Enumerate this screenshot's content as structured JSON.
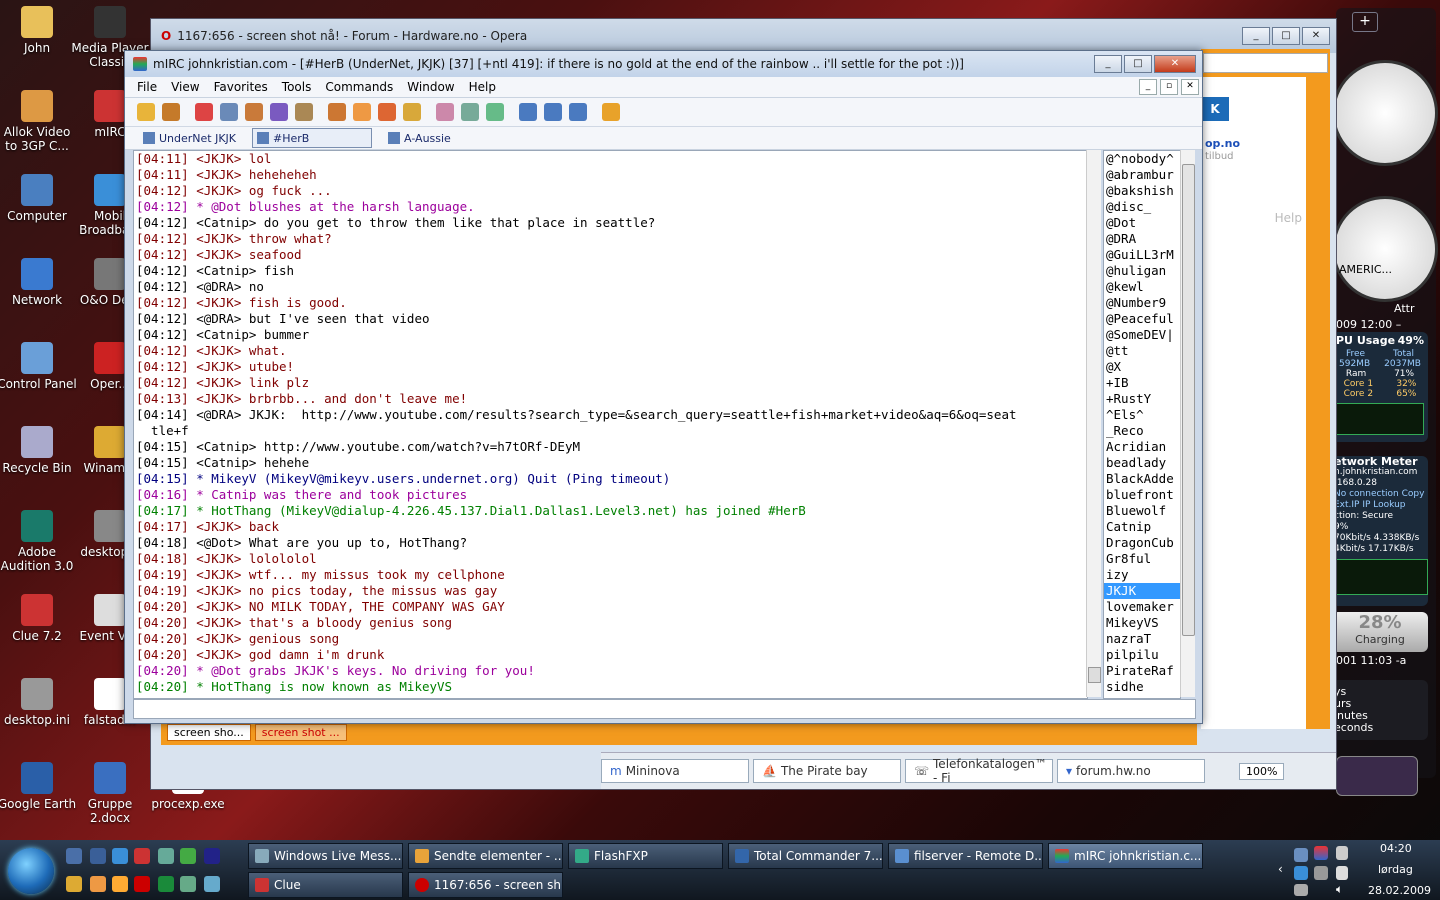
{
  "desktop": {
    "icons": [
      {
        "label": "John",
        "color": "#e8c05a"
      },
      {
        "label": "Media Player Classic",
        "color": "#333"
      },
      {
        "label": "Allok Video to 3GP C...",
        "color": "#d94"
      },
      {
        "label": "mIRC",
        "color": "#c33"
      },
      {
        "label": "Computer",
        "color": "#4a7fc0"
      },
      {
        "label": "Mobil Broadba...",
        "color": "#3a8fd8"
      },
      {
        "label": "Network",
        "color": "#3a7ad0"
      },
      {
        "label": "O&O De...",
        "color": "#777"
      },
      {
        "label": "Control Panel",
        "color": "#6a9fd8"
      },
      {
        "label": "Oper...",
        "color": "#c22"
      },
      {
        "label": "Recycle Bin",
        "color": "#aac"
      },
      {
        "label": "Winam...",
        "color": "#da3"
      },
      {
        "label": "Adobe Audition 3.0",
        "color": "#1a7a6a"
      },
      {
        "label": "desktop...",
        "color": "#888"
      },
      {
        "label": "Clue 7.2",
        "color": "#c33"
      },
      {
        "label": "Event Vi...",
        "color": "#ddd"
      },
      {
        "label": "desktop.ini",
        "color": "#999"
      },
      {
        "label": "falstad...",
        "color": "#fff"
      },
      {
        "label": "Google Earth",
        "color": "#2a5fa8"
      },
      {
        "label": "Gruppe 2.docx",
        "color": "#3a6fc0"
      },
      {
        "label": "procexp.exe",
        "color": "#fff"
      }
    ]
  },
  "gadgets": {
    "cpu_title": "PU Usage",
    "cpu_pct": "49%",
    "cpu_free": "Free",
    "cpu_total": "Total",
    "ram_free": "592MB",
    "ram_total": "2037MB",
    "ram_label": "Ram",
    "ram_pct": "71%",
    "core1_label": "Core 1",
    "core1_pct": "32%",
    "core2_label": "Core 2",
    "core2_pct": "65%",
    "net_title": "etwork Meter",
    "net_host": "n.johnkristian.com",
    "net_ip": ".168.0.28",
    "net_noconn": "No connection",
    "net_copy": "Copy",
    "net_extip": "Ext.IP",
    "net_iplookup": "IP Lookup",
    "net_secure": "ction: Secure",
    "net_pct": "9%",
    "net_in": "70Kbit/s",
    "net_in2": "4.338KB/s",
    "net_out": "4Kbit/s",
    "net_out2": "17.17KB/s",
    "battery_pct": "28%",
    "battery_status": "Charging",
    "date1": "009 12:00 –",
    "date2": "001 11:03 -a",
    "clock2_label": "AMERIC...",
    "attr": "Attr",
    "uptime_lines": [
      "ys",
      "urs",
      "inutes",
      "econds"
    ]
  },
  "opera": {
    "title": "1167:656 - screen shot nå! - Forum - Hardware.no - Opera",
    "tabs": [
      "screen sho...",
      "screen shot ..."
    ],
    "bookmarks": [
      "Mininova",
      "The Pirate bay",
      "Telefonkatalogen™ - Fi",
      "forum.hw.no"
    ],
    "zoom": "100%",
    "side_text1": "op.no",
    "side_text2": "tilbud",
    "side_help": "Help",
    "side_btn": "K"
  },
  "mirc": {
    "title": "mIRC johnkristian.com - [#HerB (UnderNet, JKJK) [37] [+ntl 419]: if there is no gold at the end of the rainbow .. i'll settle for the pot :))]",
    "menu": [
      "File",
      "View",
      "Favorites",
      "Tools",
      "Commands",
      "Window",
      "Help"
    ],
    "switchbar": [
      "UnderNet JKJK",
      "#HerB",
      "A-Aussie"
    ],
    "toolbar_colors": [
      "#e8b43a",
      "#c57a2a",
      "#d44",
      "#6a8ab8",
      "#c97a3a",
      "#7a5ac0",
      "#a85",
      "#c73",
      "#e94",
      "#d63",
      "#d8a83a",
      "#c8a",
      "#7a9",
      "#6b8",
      "#4a7ac0",
      "#4a7ac0",
      "#4a7ac0",
      "#e8a22a"
    ],
    "chat": [
      {
        "t": "[04:11] <JKJK> lol",
        "c": "#800000"
      },
      {
        "t": "[04:11] <JKJK> heheheheh",
        "c": "#800000"
      },
      {
        "t": "[04:12] <JKJK> og fuck ...",
        "c": "#800000"
      },
      {
        "t": "[04:12] * @Dot blushes at the harsh language.",
        "c": "#9c009c"
      },
      {
        "t": "[04:12] <Catnip> do you get to throw them like that place in seattle?",
        "c": "#000000"
      },
      {
        "t": "[04:12] <JKJK> throw what?",
        "c": "#800000"
      },
      {
        "t": "[04:12] <JKJK> seafood",
        "c": "#800000"
      },
      {
        "t": "[04:12] <Catnip> fish",
        "c": "#000000"
      },
      {
        "t": "[04:12] <@DRA> no",
        "c": "#000000"
      },
      {
        "t": "[04:12] <JKJK> fish is good.",
        "c": "#800000"
      },
      {
        "t": "[04:12] <@DRA> but I've seen that video",
        "c": "#000000"
      },
      {
        "t": "[04:12] <Catnip> bummer",
        "c": "#000000"
      },
      {
        "t": "[04:12] <JKJK> what.",
        "c": "#800000"
      },
      {
        "t": "[04:12] <JKJK> utube!",
        "c": "#800000"
      },
      {
        "t": "[04:12] <JKJK> link plz",
        "c": "#800000"
      },
      {
        "t": "[04:13] <JKJK> brbrbb... and don't leave me!",
        "c": "#800000"
      },
      {
        "t": "[04:14] <@DRA> JKJK:  http://www.youtube.com/results?search_type=&search_query=seattle+fish+market+video&aq=6&oq=seat",
        "c": "#000000"
      },
      {
        "t": "  tle+f",
        "c": "#000000"
      },
      {
        "t": "[04:15] <Catnip> http://www.youtube.com/watch?v=h7tORf-DEyM",
        "c": "#000000"
      },
      {
        "t": "[04:15] <Catnip> hehehe",
        "c": "#000000"
      },
      {
        "t": "[04:15] * MikeyV (MikeyV@mikeyv.users.undernet.org) Quit (Ping timeout)",
        "c": "#00007f"
      },
      {
        "t": "[04:16] * Catnip was there and took pictures",
        "c": "#9c009c"
      },
      {
        "t": "[04:17] * HotThang (MikeyV@dialup-4.226.45.137.Dial1.Dallas1.Level3.net) has joined #HerB",
        "c": "#008000"
      },
      {
        "t": "[04:17] <JKJK> back",
        "c": "#800000"
      },
      {
        "t": "[04:18] <@Dot> What are you up to, HotThang?",
        "c": "#000000"
      },
      {
        "t": "[04:18] <JKJK> lolololol",
        "c": "#800000"
      },
      {
        "t": "[04:19] <JKJK> wtf... my missus took my cellphone",
        "c": "#800000"
      },
      {
        "t": "[04:19] <JKJK> no pics today, the missus was gay",
        "c": "#800000"
      },
      {
        "t": "[04:20] <JKJK> NO MILK TODAY, THE COMPANY WAS GAY",
        "c": "#800000"
      },
      {
        "t": "[04:20] <JKJK> that's a bloody genius song",
        "c": "#800000"
      },
      {
        "t": "[04:20] <JKJK> genious song",
        "c": "#800000"
      },
      {
        "t": "[04:20] <JKJK> god damn i'm drunk",
        "c": "#800000"
      },
      {
        "t": "[04:20] * @Dot grabs JKJK's keys. No driving for you!",
        "c": "#9c009c"
      },
      {
        "t": "[04:20] * HotThang is now known as MikeyVS",
        "c": "#008000"
      }
    ],
    "nicks": [
      "@^nobody^",
      "@abrambur",
      "@bakshish",
      "@disc_",
      "@Dot",
      "@DRA",
      "@GuiLL3rM",
      "@huligan",
      "@kewl",
      "@Number9",
      "@Peaceful",
      "@SomeDEV|",
      "@tt",
      "@X",
      "+IB",
      "+RustY",
      "^Els^",
      "_Reco",
      "Acridian",
      "beadlady",
      "BlackAdde",
      "bluefront",
      "Bluewolf",
      "Catnip",
      "DragonCub",
      "Gr8ful",
      "izy",
      "JKJK",
      "lovemaker",
      "MikeyVS",
      "nazraT",
      "pilpilu",
      "PirateRaf",
      "sidhe"
    ],
    "selected_nick": "JKJK"
  },
  "taskbar": {
    "row1": [
      "Windows Live Mess...",
      "Sendte elementer - ...",
      "FlashFXP",
      "Total Commander 7....",
      "filserver - Remote D...",
      "mIRC johnkristian.c..."
    ],
    "row2": [
      "Clue",
      "1167:656 - screen sh..."
    ],
    "time": "04:20",
    "day": "lørdag",
    "date": "28.02.2009"
  }
}
